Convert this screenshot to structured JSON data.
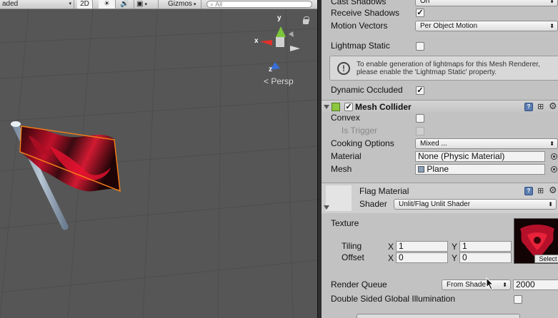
{
  "scene": {
    "toolbar": {
      "shading_mode": "aded",
      "mode_2d": "2D",
      "gizmos_label": "Gizmos",
      "search_placeholder": "All"
    },
    "gizmo": {
      "x_label": "x",
      "y_label": "y",
      "z_label": "z"
    },
    "projection_label": "Persp"
  },
  "inspector": {
    "cast_shadows": {
      "label": "Cast Shadows",
      "value": "On"
    },
    "receive_shadows": {
      "label": "Receive Shadows",
      "checked": true
    },
    "motion_vectors": {
      "label": "Motion Vectors",
      "value": "Per Object Motion"
    },
    "lightmap_static": {
      "label": "Lightmap Static",
      "checked": false
    },
    "help_text_line1": "To enable generation of lightmaps for this Mesh Renderer,",
    "help_text_line2": "please enable the 'Lightmap Static' property.",
    "dynamic_occluded": {
      "label": "Dynamic Occluded",
      "checked": true
    },
    "mesh_collider": {
      "title": "Mesh Collider",
      "enabled": true,
      "convex": {
        "label": "Convex",
        "checked": false
      },
      "is_trigger": {
        "label": "Is Trigger",
        "checked": false
      },
      "cooking_options": {
        "label": "Cooking Options",
        "value": "Mixed ..."
      },
      "material": {
        "label": "Material",
        "value": "None (Physic Material)"
      },
      "mesh": {
        "label": "Mesh",
        "value": "Plane"
      }
    },
    "material": {
      "name": "Flag Material",
      "shader_label": "Shader",
      "shader_value": "Unlit/Flag Unlit Shader",
      "texture_label": "Texture",
      "tiling_label": "Tiling",
      "offset_label": "Offset",
      "x_label": "X",
      "y_label": "Y",
      "tiling_x": "1",
      "tiling_y": "1",
      "offset_x": "0",
      "offset_y": "0",
      "select_label": "Select",
      "render_queue": {
        "label": "Render Queue",
        "mode": "From Shader",
        "value": "2000"
      },
      "double_sided_gi": {
        "label": "Double Sided Global Illumination",
        "checked": false
      }
    }
  },
  "colors": {
    "scene_bg": "#565656",
    "inspector_bg": "#c2c2c2",
    "selection_outline": "#f07c1a",
    "flag_red": "#c0102a"
  }
}
